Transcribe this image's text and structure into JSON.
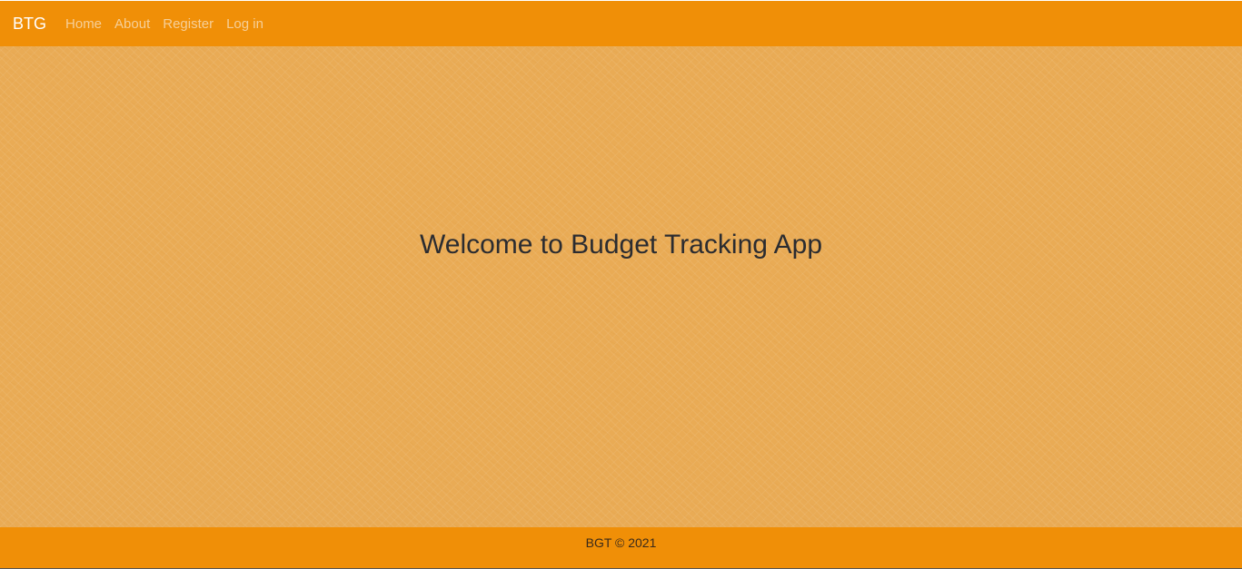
{
  "navbar": {
    "brand": "BTG",
    "links": [
      "Home",
      "About",
      "Register",
      "Log in"
    ]
  },
  "hero": {
    "title": "Welcome to Budget Tracking App"
  },
  "footer": {
    "text": "BGT © 2021"
  },
  "colors": {
    "navbar_background": "#f08f07",
    "hero_background": "#e9ab55",
    "nav_link": "#f6cf98",
    "title_text": "#2b2c30"
  }
}
